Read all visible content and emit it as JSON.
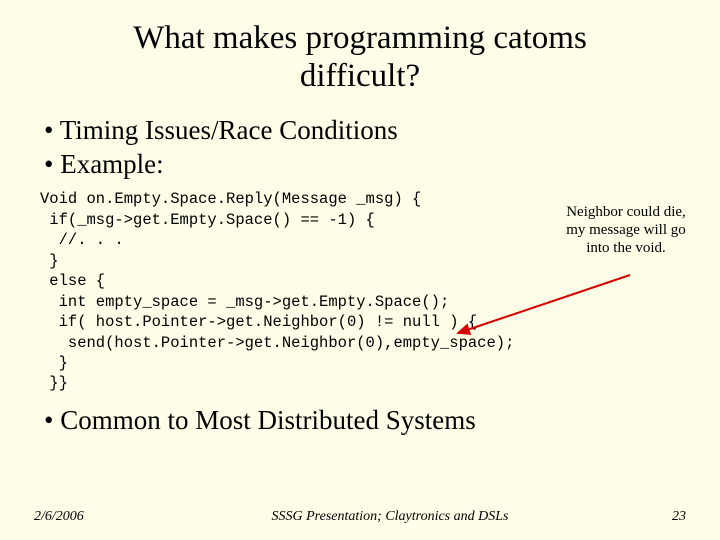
{
  "title": "What makes programming catoms difficult?",
  "bullets_top": {
    "b1": "Timing Issues/Race Conditions",
    "b2": "Example:"
  },
  "code": "Void on.Empty.Space.Reply(Message _msg) {\n if(_msg->get.Empty.Space() == -1) {\n  //. . .\n }\n else {\n  int empty_space = _msg->get.Empty.Space();\n  if( host.Pointer->get.Neighbor(0) != null ) {\n   send(host.Pointer->get.Neighbor(0),empty_space);\n  }\n }}",
  "annotation": "Neighbor could die, my message will go into the void.",
  "bullets_bottom": {
    "b1": "Common to Most Distributed Systems"
  },
  "footer": {
    "date": "2/6/2006",
    "center": "SSSG Presentation; Claytronics and DSLs",
    "page": "23"
  }
}
